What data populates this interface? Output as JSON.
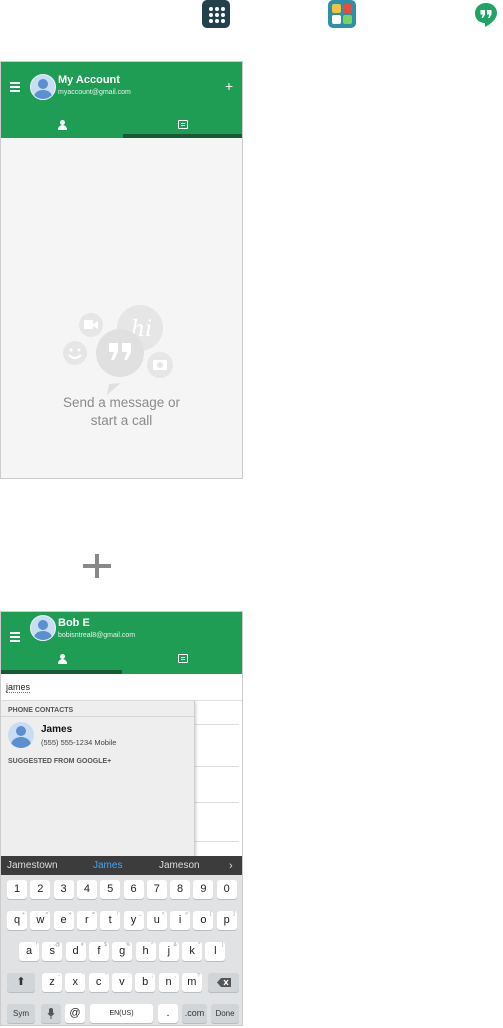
{
  "top_icons": [
    "apps-icon",
    "app-folder-icon",
    "hangouts-icon"
  ],
  "screen1": {
    "account_name": "My Account",
    "account_email": "myaccount@gmail.com",
    "empty_line1": "Send a message or",
    "empty_line2": "start a call",
    "hi_text": "hi"
  },
  "screen2": {
    "account_name": "Bob E",
    "account_email": "bobisntreal8@gmail.com",
    "search_value": "james",
    "phone_contacts_header": "PHONE CONTACTS",
    "contact_name": "James",
    "contact_detail": "(555) 555-1234 Mobile",
    "suggested_header": "SUGGESTED FROM GOOGLE+"
  },
  "keyboard": {
    "suggestions": [
      "Jamestown",
      "James",
      "Jameson"
    ],
    "row_numbers": [
      "1",
      "2",
      "3",
      "4",
      "5",
      "6",
      "7",
      "8",
      "9",
      "0"
    ],
    "row_q": [
      "q",
      "w",
      "e",
      "r",
      "t",
      "y",
      "u",
      "i",
      "o",
      "p"
    ],
    "row_q_sup": [
      "+",
      "×",
      "÷",
      "=",
      "/",
      "_",
      "<",
      ">",
      "[",
      "]"
    ],
    "row_a": [
      "a",
      "s",
      "d",
      "f",
      "g",
      "h",
      "j",
      "k",
      "l"
    ],
    "row_a_sup": [
      "!",
      "@",
      "#",
      "$",
      "%",
      "^",
      "&",
      "*",
      "("
    ],
    "row_z": [
      "z",
      "x",
      "c",
      "v",
      "b",
      "n",
      "m"
    ],
    "row_z_sup": [
      "-",
      "'",
      "\"",
      ":",
      ";",
      ",",
      "?"
    ],
    "sym": "Sym",
    "at": "@",
    "space": "EN(US)",
    "period": ".",
    "com": ".com",
    "done": "Done"
  },
  "colors": {
    "green": "#1f9d55",
    "dark_green": "#175a33",
    "suggestion_highlight": "#3fa9f5"
  }
}
